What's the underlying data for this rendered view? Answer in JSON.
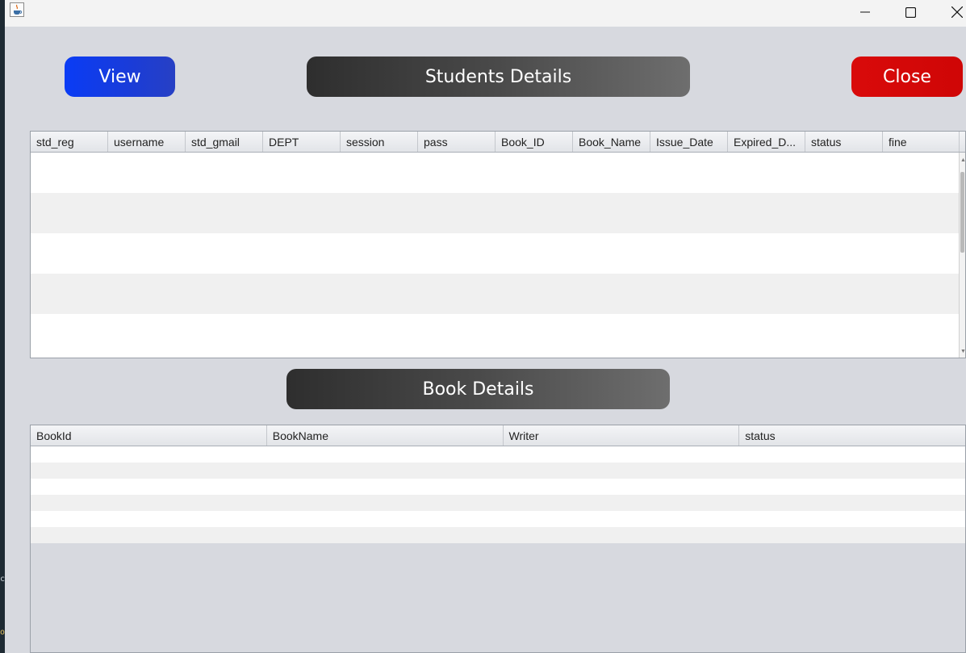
{
  "window": {
    "icon": "java-cup-icon",
    "controls": [
      "minimize-icon",
      "maximize-icon",
      "close-icon"
    ]
  },
  "buttons": {
    "view_label": "View",
    "close_label": "Close"
  },
  "colors": {
    "view_button": "#0a3cf5",
    "close_button": "#d90a0a",
    "banner_dark": "#2e2e2e",
    "banner_light": "#6e6e6e",
    "background": "#d7d9df"
  },
  "students": {
    "title": "Students Details",
    "columns": [
      "std_reg",
      "username",
      "std_gmail",
      "DEPT",
      "session",
      "pass",
      "Book_ID",
      "Book_Name",
      "Issue_Date",
      "Expired_D...",
      "status",
      "fine"
    ],
    "rows": []
  },
  "books": {
    "title": "Book Details",
    "columns": [
      "BookId",
      "BookName",
      "Writer",
      "status"
    ],
    "rows": []
  }
}
